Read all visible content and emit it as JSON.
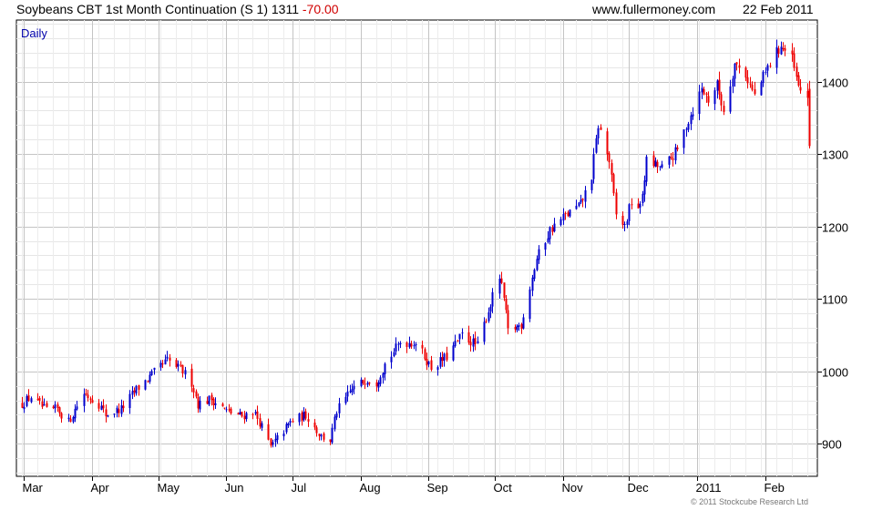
{
  "header": {
    "title": "Soybeans CBT 1st Month Continuation (S 1) 1311",
    "change": "-70.00",
    "site": "www.fullermoney.com",
    "date": "22 Feb 2011"
  },
  "copyright": "© 2011 Stockcube Research Ltd",
  "colors": {
    "up": "#0000cc",
    "down": "#ee0000",
    "grid": "#cccccc",
    "axis": "#000000",
    "interval_label": "#0000aa"
  },
  "chart_data": {
    "type": "candlestick",
    "interval_label": "Daily",
    "ylim": [
      855,
      1485
    ],
    "yticks": [
      900,
      1000,
      1100,
      1200,
      1300,
      1400
    ],
    "grid": true,
    "y_axis_side": "right",
    "x_tick_labels": [
      "Mar",
      "Apr",
      "May",
      "Jun",
      "Jul",
      "Aug",
      "Sep",
      "Oct",
      "Nov",
      "Dec",
      "2011",
      "Feb"
    ],
    "x_tick_days": [
      1,
      32,
      62,
      93,
      123,
      154,
      185,
      215,
      246,
      276,
      307,
      338
    ],
    "start_date": "2010-03-01",
    "end_date": "2011-02-22",
    "close_path": [
      [
        "2010-03-01",
        955
      ],
      [
        "2010-03-05",
        965
      ],
      [
        "2010-03-12",
        945
      ],
      [
        "2010-03-17",
        948
      ],
      [
        "2010-03-22",
        930
      ],
      [
        "2010-03-29",
        970
      ],
      [
        "2010-04-05",
        955
      ],
      [
        "2010-04-08",
        940
      ],
      [
        "2010-04-15",
        948
      ],
      [
        "2010-04-22",
        975
      ],
      [
        "2010-04-29",
        995
      ],
      [
        "2010-05-06",
        1015
      ],
      [
        "2010-05-13",
        1000
      ],
      [
        "2010-05-17",
        985
      ],
      [
        "2010-05-20",
        955
      ],
      [
        "2010-05-26",
        962
      ],
      [
        "2010-06-02",
        945
      ],
      [
        "2010-06-09",
        938
      ],
      [
        "2010-06-14",
        945
      ],
      [
        "2010-06-17",
        930
      ],
      [
        "2010-06-22",
        895
      ],
      [
        "2010-07-01",
        930
      ],
      [
        "2010-07-08",
        940
      ],
      [
        "2010-07-15",
        910
      ],
      [
        "2010-07-19",
        905
      ],
      [
        "2010-07-22",
        945
      ],
      [
        "2010-07-29",
        975
      ],
      [
        "2010-08-05",
        990
      ],
      [
        "2010-08-09",
        985
      ],
      [
        "2010-08-13",
        1010
      ],
      [
        "2010-08-20",
        1040
      ],
      [
        "2010-08-27",
        1040
      ],
      [
        "2010-09-03",
        1005
      ],
      [
        "2010-09-10",
        1020
      ],
      [
        "2010-09-17",
        1050
      ],
      [
        "2010-09-24",
        1035
      ],
      [
        "2010-09-28",
        1075
      ],
      [
        "2010-10-04",
        1130
      ],
      [
        "2010-10-06",
        1100
      ],
      [
        "2010-10-08",
        1055
      ],
      [
        "2010-10-14",
        1065
      ],
      [
        "2010-10-19",
        1130
      ],
      [
        "2010-10-21",
        1155
      ],
      [
        "2010-10-27",
        1195
      ],
      [
        "2010-11-03",
        1215
      ],
      [
        "2010-11-10",
        1230
      ],
      [
        "2010-11-15",
        1270
      ],
      [
        "2010-11-18",
        1340
      ],
      [
        "2010-11-23",
        1290
      ],
      [
        "2010-11-26",
        1215
      ],
      [
        "2010-11-30",
        1200
      ],
      [
        "2010-12-03",
        1235
      ],
      [
        "2010-12-07",
        1225
      ],
      [
        "2010-12-10",
        1290
      ],
      [
        "2010-12-17",
        1280
      ],
      [
        "2010-12-24",
        1305
      ],
      [
        "2010-12-28",
        1340
      ],
      [
        "2011-01-04",
        1390
      ],
      [
        "2011-01-07",
        1375
      ],
      [
        "2011-01-11",
        1395
      ],
      [
        "2011-01-14",
        1360
      ],
      [
        "2011-01-19",
        1425
      ],
      [
        "2011-01-24",
        1410
      ],
      [
        "2011-01-28",
        1380
      ],
      [
        "2011-02-04",
        1425
      ],
      [
        "2011-02-09",
        1450
      ],
      [
        "2011-02-14",
        1430
      ],
      [
        "2011-02-17",
        1390
      ],
      [
        "2011-02-21",
        1381
      ],
      [
        "2011-02-22",
        1311
      ]
    ]
  }
}
